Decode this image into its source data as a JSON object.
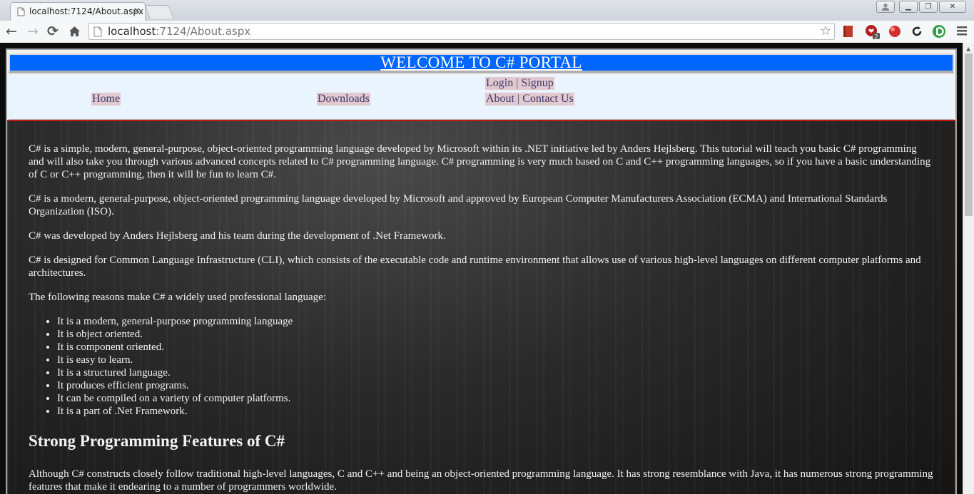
{
  "browser": {
    "tab_title": "localhost:7124/About.aspx",
    "url_host": "localhost",
    "url_rest": ":7124/About.aspx",
    "colors": {
      "chrome": "#dfe3e8",
      "toolbar": "#f6f7f8"
    }
  },
  "header": {
    "banner_title": "WELCOME TO C# PORTAL",
    "colors": {
      "banner": "#0066ff",
      "nav_background": "#eaf4ff",
      "nav_highlight": "#e2c8cf"
    }
  },
  "nav": {
    "home": "Home",
    "downloads": "Downloads",
    "login": "Login",
    "signup": "Signup",
    "about": "About",
    "contact": "Contact Us",
    "separator": "|"
  },
  "content": {
    "paragraphs": [
      "C# is a simple, modern, general-purpose, object-oriented programming language developed by Microsoft within its .NET initiative led by Anders Hejlsberg. This tutorial will teach you basic C# programming and will also take you through various advanced concepts related to C# programming language. C# programming is very much based on C and C++ programming languages, so if you have a basic understanding of C or C++ programming, then it will be fun to learn C#.",
      "C# is a modern, general-purpose, object-oriented programming language developed by Microsoft and approved by European Computer Manufacturers Association (ECMA) and International Standards Organization (ISO).",
      "C# was developed by Anders Hejlsberg and his team during the development of .Net Framework.",
      "C# is designed for Common Language Infrastructure (CLI), which consists of the executable code and runtime environment that allows use of various high-level languages on different computer platforms and architectures.",
      "The following reasons make C# a widely used professional language:"
    ],
    "reasons": [
      "It is a modern, general-purpose programming language",
      "It is object oriented.",
      "It is component oriented.",
      "It is easy to learn.",
      "It is a structured language.",
      "It produces efficient programs.",
      "It can be compiled on a variety of computer platforms.",
      "It is a part of .Net Framework."
    ],
    "features_heading": "Strong Programming Features of C#",
    "features_paragraph": "Although C# constructs closely follow traditional high-level languages, C and C++ and being an object-oriented programming language. It has strong resemblance with Java, it has numerous strong programming features that make it endearing to a number of programmers worldwide."
  }
}
